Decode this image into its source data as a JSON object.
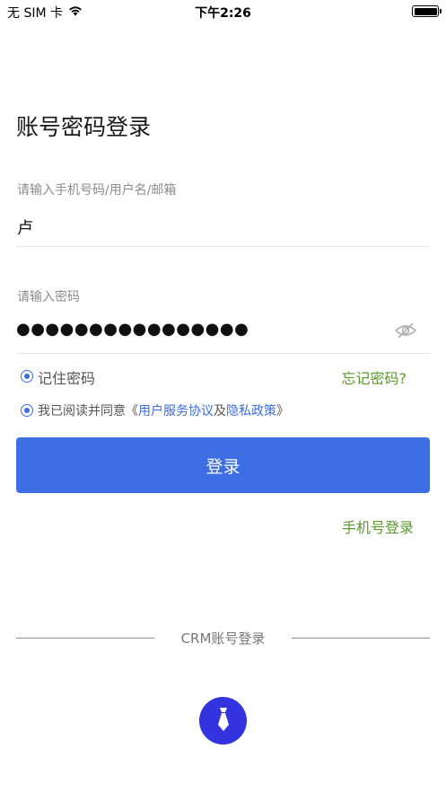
{
  "status_bar": {
    "carrier": "无 SIM 卡",
    "time": "下午2:26"
  },
  "page_title": "账号密码登录",
  "account": {
    "placeholder": "请输入手机号码/用户名/邮箱",
    "value": "卢"
  },
  "password": {
    "placeholder": "请输入密码",
    "value": "●●●●●●●●●●●●●●●●"
  },
  "remember": {
    "label": "记住密码",
    "checked": true
  },
  "forgot_password": "忘记密码?",
  "agreement": {
    "prefix": "我已阅读并同意《",
    "terms": "用户服务协议",
    "and": "及",
    "privacy": "隐私政策",
    "suffix": "》",
    "checked": true
  },
  "login_button": "登录",
  "phone_login": "手机号登录",
  "crm_login": "CRM账号登录",
  "colors": {
    "primary": "#3e6ee3",
    "link_green": "#5a9a2e",
    "crm_button": "#3333e0"
  },
  "icons": {
    "wifi": "wifi-icon",
    "battery": "battery-icon",
    "eye": "eye-off-icon",
    "crm": "tie-icon"
  }
}
